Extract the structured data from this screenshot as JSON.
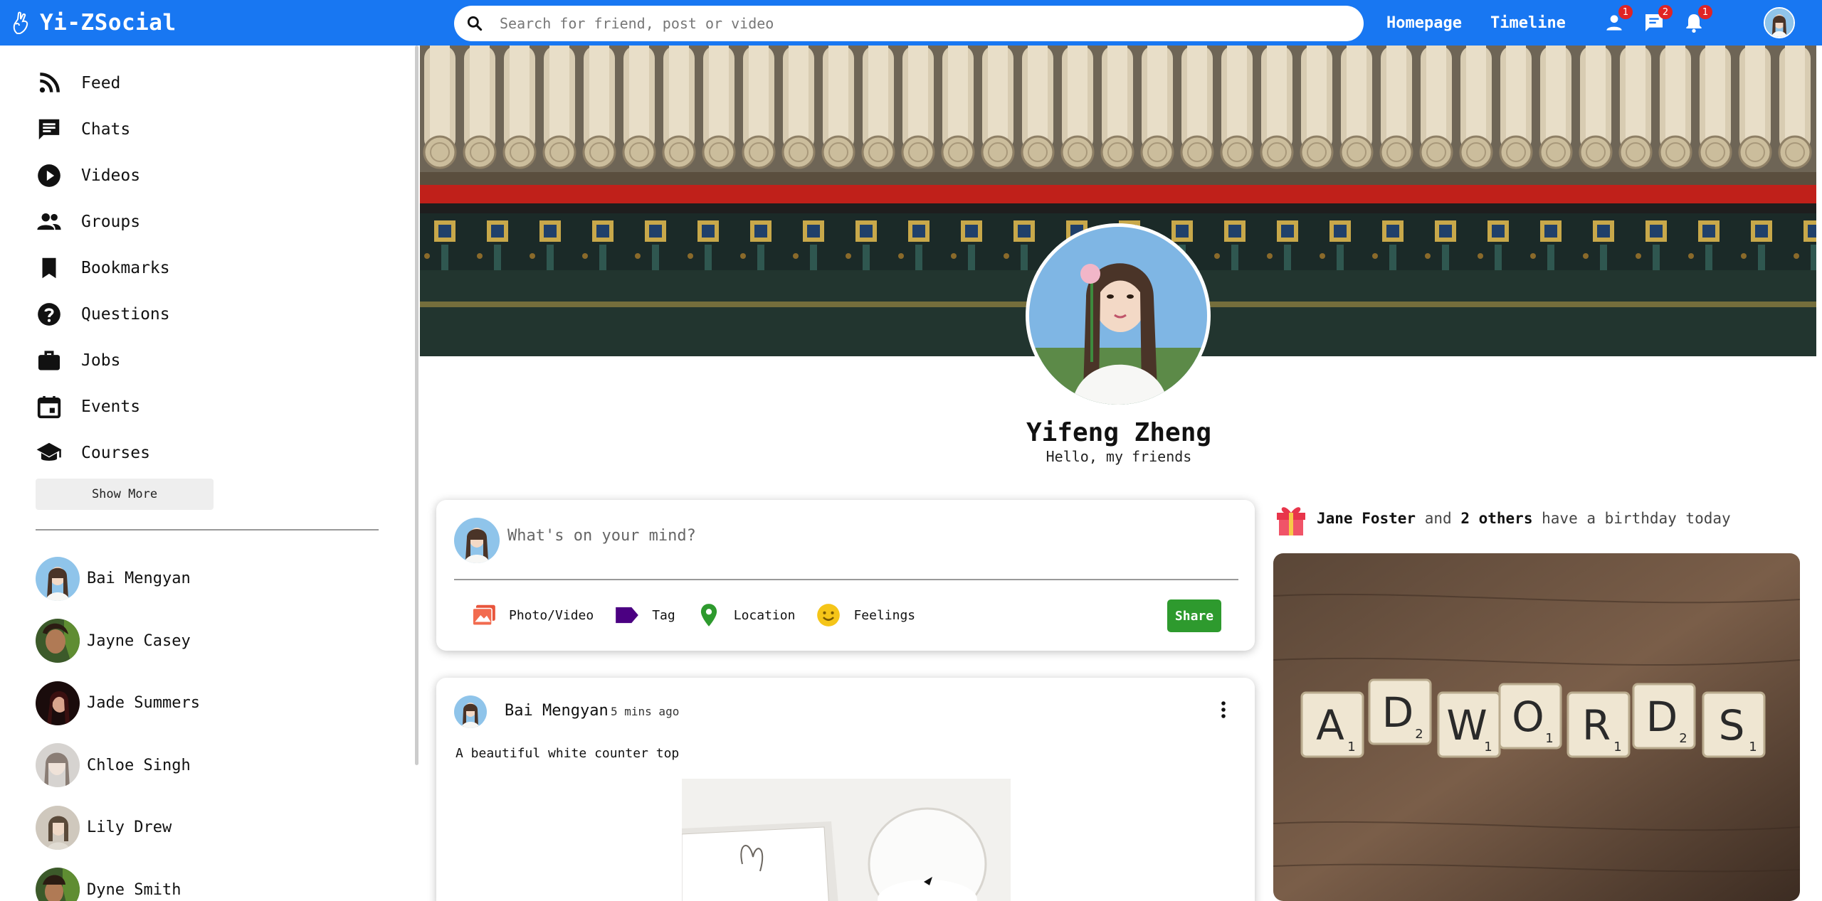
{
  "app": {
    "title": "Yi-ZSocial",
    "accent_color": "#1877f2"
  },
  "search": {
    "placeholder": "Search for friend, post or video"
  },
  "nav": {
    "links": [
      "Homepage",
      "Timeline"
    ],
    "icons": [
      {
        "name": "person-icon",
        "badge": "1"
      },
      {
        "name": "chat-icon",
        "badge": "2"
      },
      {
        "name": "notifications-icon",
        "badge": "1"
      }
    ]
  },
  "sidebar": {
    "items": [
      {
        "label": "Feed",
        "icon": "rss-feed-icon"
      },
      {
        "label": "Chats",
        "icon": "chat-icon"
      },
      {
        "label": "Videos",
        "icon": "play-circle-icon"
      },
      {
        "label": "Groups",
        "icon": "group-icon"
      },
      {
        "label": "Bookmarks",
        "icon": "bookmark-icon"
      },
      {
        "label": "Questions",
        "icon": "help-circle-icon"
      },
      {
        "label": "Jobs",
        "icon": "work-icon"
      },
      {
        "label": "Events",
        "icon": "event-icon"
      },
      {
        "label": "Courses",
        "icon": "school-icon"
      }
    ],
    "show_more_label": "Show More",
    "friends": [
      "Bai Mengyan",
      "Jayne Casey",
      "Jade Summers",
      "Chloe Singh",
      "Lily Drew",
      "Dyne Smith"
    ]
  },
  "profile": {
    "name": "Yifeng Zheng",
    "bio": "Hello, my friends"
  },
  "share": {
    "placeholder": "What's on your mind?",
    "options": [
      {
        "label": "Photo/Video",
        "icon": "photo-icon",
        "color": "#e8553c"
      },
      {
        "label": "Tag",
        "icon": "tag-icon",
        "color": "#4b0082"
      },
      {
        "label": "Location",
        "icon": "location-icon",
        "color": "#2e9a2e"
      },
      {
        "label": "Feelings",
        "icon": "emoji-icon",
        "color": "#f5c518"
      }
    ],
    "button_label": "Share",
    "button_color": "#2e9a2e"
  },
  "post": {
    "author": "Bai Mengyan",
    "time": "5 mins ago",
    "text": "A beautiful white counter top"
  },
  "birthday": {
    "name": "Jane Foster",
    "connector": "and",
    "others": "2 others",
    "suffix": "have a birthday today"
  },
  "ad": {
    "tiles": [
      {
        "letter": "A",
        "score": "1"
      },
      {
        "letter": "D",
        "score": "2"
      },
      {
        "letter": "W",
        "score": "1"
      },
      {
        "letter": "O",
        "score": "1"
      },
      {
        "letter": "R",
        "score": "1"
      },
      {
        "letter": "D",
        "score": "2"
      },
      {
        "letter": "S",
        "score": "1"
      }
    ]
  }
}
